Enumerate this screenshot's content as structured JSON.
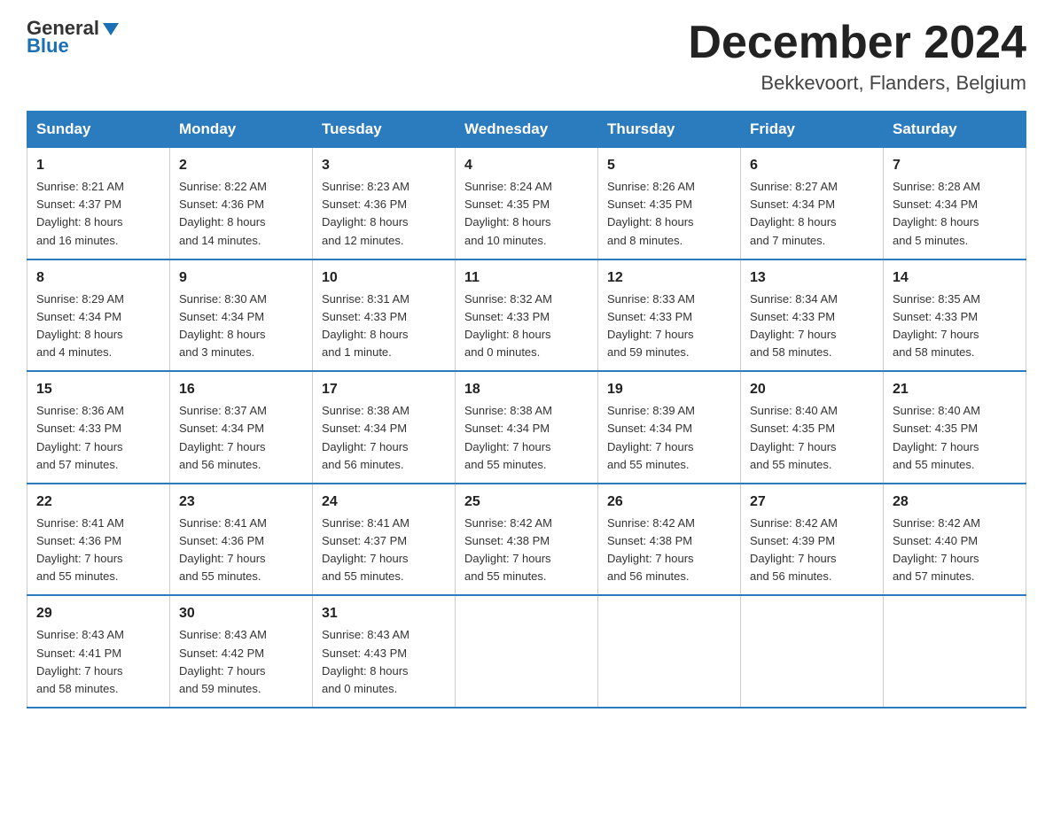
{
  "logo": {
    "text_general": "General",
    "text_blue": "Blue",
    "arrow": "▲"
  },
  "header": {
    "month_title": "December 2024",
    "subtitle": "Bekkevoort, Flanders, Belgium"
  },
  "weekdays": [
    "Sunday",
    "Monday",
    "Tuesday",
    "Wednesday",
    "Thursday",
    "Friday",
    "Saturday"
  ],
  "weeks": [
    [
      {
        "day": "1",
        "info": "Sunrise: 8:21 AM\nSunset: 4:37 PM\nDaylight: 8 hours\nand 16 minutes."
      },
      {
        "day": "2",
        "info": "Sunrise: 8:22 AM\nSunset: 4:36 PM\nDaylight: 8 hours\nand 14 minutes."
      },
      {
        "day": "3",
        "info": "Sunrise: 8:23 AM\nSunset: 4:36 PM\nDaylight: 8 hours\nand 12 minutes."
      },
      {
        "day": "4",
        "info": "Sunrise: 8:24 AM\nSunset: 4:35 PM\nDaylight: 8 hours\nand 10 minutes."
      },
      {
        "day": "5",
        "info": "Sunrise: 8:26 AM\nSunset: 4:35 PM\nDaylight: 8 hours\nand 8 minutes."
      },
      {
        "day": "6",
        "info": "Sunrise: 8:27 AM\nSunset: 4:34 PM\nDaylight: 8 hours\nand 7 minutes."
      },
      {
        "day": "7",
        "info": "Sunrise: 8:28 AM\nSunset: 4:34 PM\nDaylight: 8 hours\nand 5 minutes."
      }
    ],
    [
      {
        "day": "8",
        "info": "Sunrise: 8:29 AM\nSunset: 4:34 PM\nDaylight: 8 hours\nand 4 minutes."
      },
      {
        "day": "9",
        "info": "Sunrise: 8:30 AM\nSunset: 4:34 PM\nDaylight: 8 hours\nand 3 minutes."
      },
      {
        "day": "10",
        "info": "Sunrise: 8:31 AM\nSunset: 4:33 PM\nDaylight: 8 hours\nand 1 minute."
      },
      {
        "day": "11",
        "info": "Sunrise: 8:32 AM\nSunset: 4:33 PM\nDaylight: 8 hours\nand 0 minutes."
      },
      {
        "day": "12",
        "info": "Sunrise: 8:33 AM\nSunset: 4:33 PM\nDaylight: 7 hours\nand 59 minutes."
      },
      {
        "day": "13",
        "info": "Sunrise: 8:34 AM\nSunset: 4:33 PM\nDaylight: 7 hours\nand 58 minutes."
      },
      {
        "day": "14",
        "info": "Sunrise: 8:35 AM\nSunset: 4:33 PM\nDaylight: 7 hours\nand 58 minutes."
      }
    ],
    [
      {
        "day": "15",
        "info": "Sunrise: 8:36 AM\nSunset: 4:33 PM\nDaylight: 7 hours\nand 57 minutes."
      },
      {
        "day": "16",
        "info": "Sunrise: 8:37 AM\nSunset: 4:34 PM\nDaylight: 7 hours\nand 56 minutes."
      },
      {
        "day": "17",
        "info": "Sunrise: 8:38 AM\nSunset: 4:34 PM\nDaylight: 7 hours\nand 56 minutes."
      },
      {
        "day": "18",
        "info": "Sunrise: 8:38 AM\nSunset: 4:34 PM\nDaylight: 7 hours\nand 55 minutes."
      },
      {
        "day": "19",
        "info": "Sunrise: 8:39 AM\nSunset: 4:34 PM\nDaylight: 7 hours\nand 55 minutes."
      },
      {
        "day": "20",
        "info": "Sunrise: 8:40 AM\nSunset: 4:35 PM\nDaylight: 7 hours\nand 55 minutes."
      },
      {
        "day": "21",
        "info": "Sunrise: 8:40 AM\nSunset: 4:35 PM\nDaylight: 7 hours\nand 55 minutes."
      }
    ],
    [
      {
        "day": "22",
        "info": "Sunrise: 8:41 AM\nSunset: 4:36 PM\nDaylight: 7 hours\nand 55 minutes."
      },
      {
        "day": "23",
        "info": "Sunrise: 8:41 AM\nSunset: 4:36 PM\nDaylight: 7 hours\nand 55 minutes."
      },
      {
        "day": "24",
        "info": "Sunrise: 8:41 AM\nSunset: 4:37 PM\nDaylight: 7 hours\nand 55 minutes."
      },
      {
        "day": "25",
        "info": "Sunrise: 8:42 AM\nSunset: 4:38 PM\nDaylight: 7 hours\nand 55 minutes."
      },
      {
        "day": "26",
        "info": "Sunrise: 8:42 AM\nSunset: 4:38 PM\nDaylight: 7 hours\nand 56 minutes."
      },
      {
        "day": "27",
        "info": "Sunrise: 8:42 AM\nSunset: 4:39 PM\nDaylight: 7 hours\nand 56 minutes."
      },
      {
        "day": "28",
        "info": "Sunrise: 8:42 AM\nSunset: 4:40 PM\nDaylight: 7 hours\nand 57 minutes."
      }
    ],
    [
      {
        "day": "29",
        "info": "Sunrise: 8:43 AM\nSunset: 4:41 PM\nDaylight: 7 hours\nand 58 minutes."
      },
      {
        "day": "30",
        "info": "Sunrise: 8:43 AM\nSunset: 4:42 PM\nDaylight: 7 hours\nand 59 minutes."
      },
      {
        "day": "31",
        "info": "Sunrise: 8:43 AM\nSunset: 4:43 PM\nDaylight: 8 hours\nand 0 minutes."
      },
      {
        "day": "",
        "info": ""
      },
      {
        "day": "",
        "info": ""
      },
      {
        "day": "",
        "info": ""
      },
      {
        "day": "",
        "info": ""
      }
    ]
  ]
}
